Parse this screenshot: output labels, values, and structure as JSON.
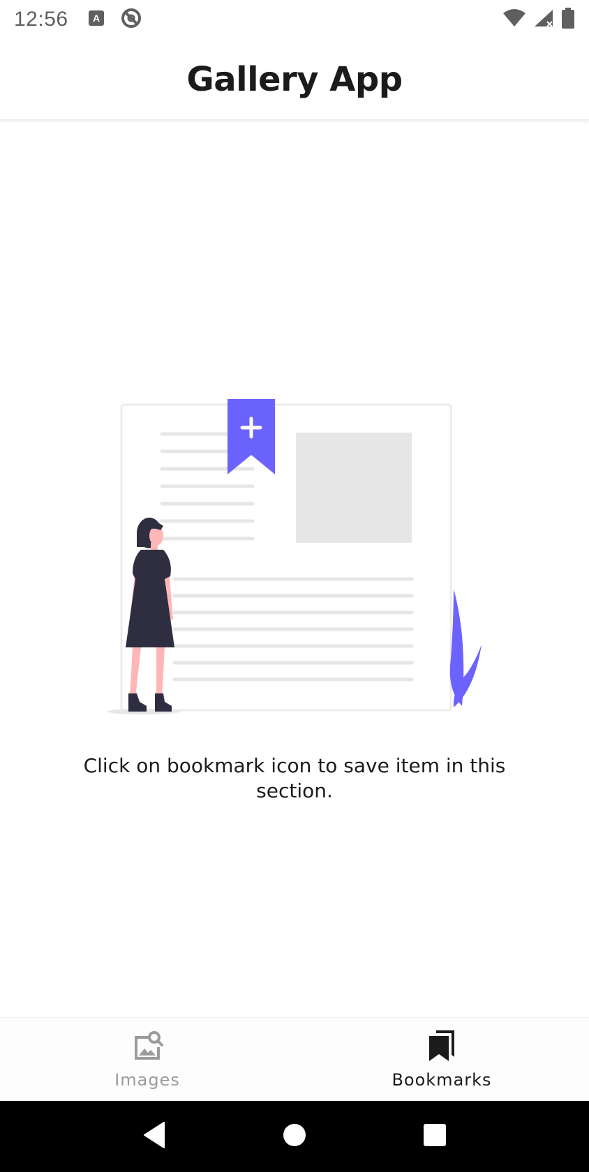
{
  "status_bar": {
    "time": "12:56",
    "icons": [
      "keyboard-a-icon",
      "no-sync-icon",
      "wifi-icon",
      "signal-icon",
      "battery-icon"
    ]
  },
  "app_bar": {
    "title": "Gallery App"
  },
  "empty_state": {
    "message": "Click on bookmark icon to save item in this section.",
    "accent_color": "#6c63ff"
  },
  "bottom_nav": {
    "items": [
      {
        "label": "Images",
        "icon": "image-search-icon",
        "active": false
      },
      {
        "label": "Bookmarks",
        "icon": "bookmarks-icon",
        "active": true
      }
    ]
  },
  "system_nav": {
    "buttons": [
      "back-icon",
      "home-icon",
      "recents-icon"
    ]
  }
}
